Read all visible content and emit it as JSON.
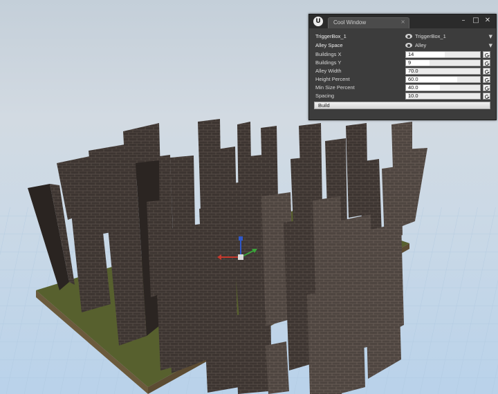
{
  "window": {
    "logo": "U",
    "tab_title": "Cool Window",
    "tab_close": "×",
    "minimize": "–",
    "maximize": "□",
    "close": "✕"
  },
  "properties": {
    "trigger": {
      "label": "TriggerBox_1",
      "value": "TriggerBox_1"
    },
    "alley": {
      "label": "Alley Space",
      "value": "Alley"
    },
    "fields": [
      {
        "label": "Buildings X",
        "value": "14",
        "fill": 0.52
      },
      {
        "label": "Buildings Y",
        "value": "9",
        "fill": 0.32
      },
      {
        "label": "Alley Width",
        "value": "70.0",
        "fill": 0.07
      },
      {
        "label": "Height Percent",
        "value": "60.0",
        "fill": 0.69
      },
      {
        "label": "Min Size Percent",
        "value": "40.0",
        "fill": 0.46
      },
      {
        "label": "Spacing",
        "value": "10.0",
        "fill": 0.03
      }
    ],
    "build_label": "Build"
  },
  "colors": {
    "sky_top": "#c7d3de",
    "sky_bottom": "#d0dae4",
    "grid_floor": "#c5d9ec",
    "grass": "#55582c",
    "brick": "#4a3f3a",
    "brick_dark": "#2c2623"
  }
}
